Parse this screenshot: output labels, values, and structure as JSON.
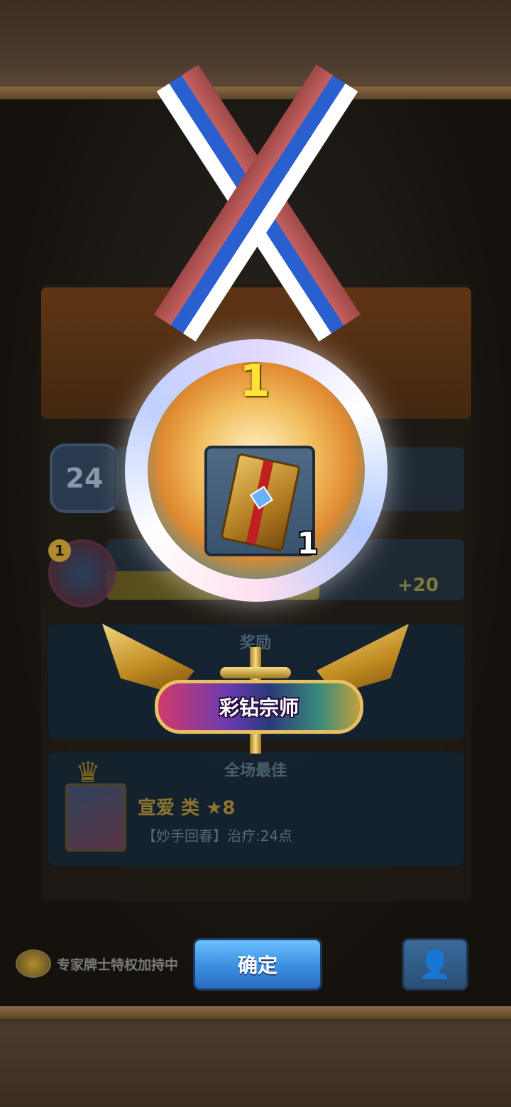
{
  "result_panel": {
    "player_level": "24",
    "unit_level": "1",
    "gain": "+20",
    "reward_title": "奖励",
    "mvp_title": "全场最佳",
    "mvp": {
      "hero_name": "宣爱 类 ★8",
      "skill": "【妙手回春】治疗:24点"
    }
  },
  "medal": {
    "rank": "1",
    "item_icon": "card-pack-icon",
    "item_count": "1",
    "title": "彩钻宗师"
  },
  "bottom_bar": {
    "privilege_text": "专家牌士特权加持中",
    "confirm_label": "确定",
    "add_friend_icon": "add-friend-icon"
  }
}
